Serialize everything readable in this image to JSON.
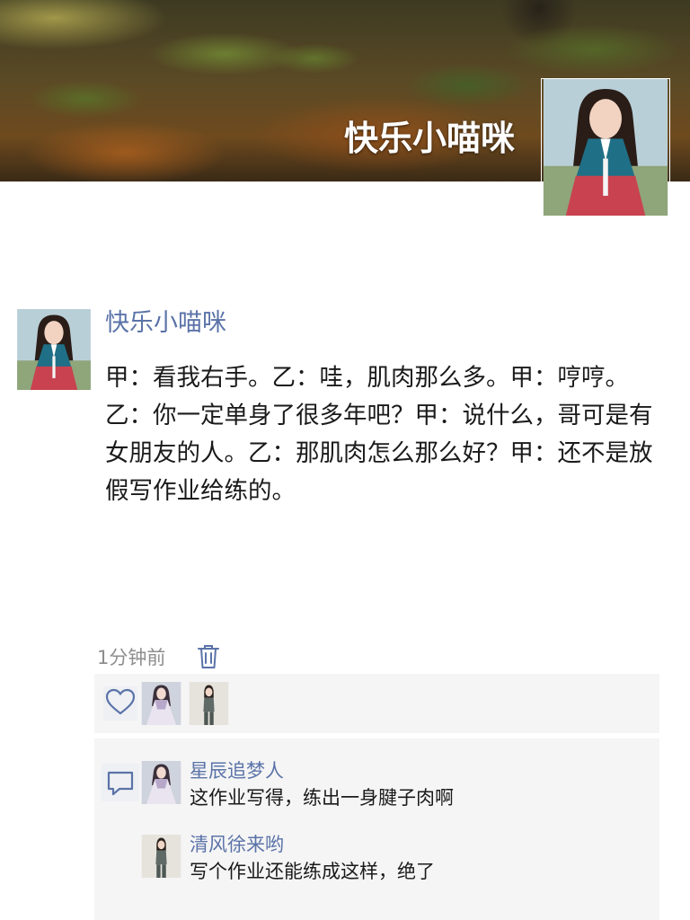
{
  "cover": {
    "title": "快乐小喵咪",
    "background": "forest-floor-photo",
    "avatar": "hanbok-girl-portrait"
  },
  "post": {
    "author": "快乐小喵咪",
    "avatar": "hanbok-girl-portrait",
    "text": "甲：看我右手。乙：哇，肌肉那么多。甲：哼哼。乙：你一定单身了很多年吧？甲：说什么，哥可是有女朋友的人。乙：那肌肉怎么那么好？甲：还不是放假写作业给练的。",
    "time": "1分钟前",
    "delete_icon": "trash-icon"
  },
  "likes": {
    "icon": "heart-icon",
    "avatars": [
      "white-dress-girl-portrait",
      "grey-outfit-girl-portrait"
    ]
  },
  "comments": {
    "icon": "comment-bubble-icon",
    "items": [
      {
        "author": "星辰追梦人",
        "text": "这作业写得，练出一身腱子肉啊",
        "avatar": "white-dress-girl-portrait"
      },
      {
        "author": "清风徐来哟",
        "text": "写个作业还能练成这样，绝了",
        "avatar": "grey-outfit-girl-portrait"
      }
    ]
  },
  "colors": {
    "link": "#5b73a8",
    "text": "#1a1a1a",
    "muted": "#8e8e8e",
    "panel": "#f5f5f5"
  }
}
